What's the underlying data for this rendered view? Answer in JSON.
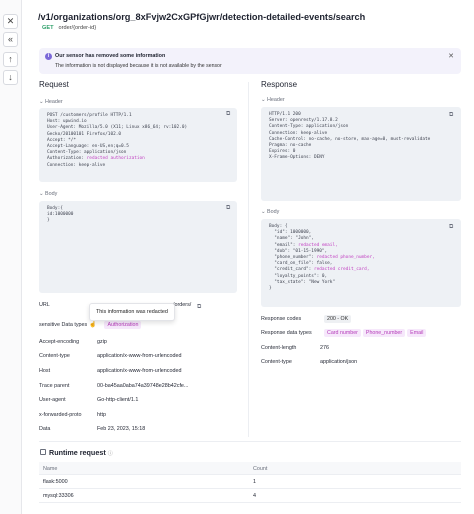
{
  "rail": {
    "close": "✕",
    "collapse": "«",
    "up": "↑",
    "down": "↓"
  },
  "header": {
    "title": "/v1/organizations/org_8xFvjw2CxGPfGjwr/detection-detailed-events/search",
    "method": "GET",
    "route": "order/{order-id}"
  },
  "alert": {
    "title": "Our sensor has removed some information",
    "text": "The information is not displayed because it is not available by the sensor"
  },
  "request": {
    "title": "Request",
    "header_label": "Header",
    "header_code": [
      "POST /customers/profile HTTP/1.1",
      "Host: upwind.io",
      "User-Agent: Mozilla/5.0 (X11; Linux x86_64; rv:102.0)",
      "Gecko/20100101 Firefox/102.0",
      "Accept: */*",
      "Accept-Language: en-US,en;q=0.5",
      "Content-Type: application/json",
      "Authorization: ",
      "Connection: keep-alive"
    ],
    "header_redacted": "redacted authorization",
    "body_label": "Body",
    "body_code": [
      "Body:{",
      "id:1000000",
      "}"
    ],
    "fields": [
      {
        "key": "URL",
        "value": "/orders/"
      },
      {
        "key": "sensitive Data types",
        "tag": "Authorization"
      },
      {
        "key": "Accept-encoding",
        "value": "gzip"
      },
      {
        "key": "Content-type",
        "value": "application/x-www-from-urlencoded"
      },
      {
        "key": "Host",
        "value": "application/x-www-from-urlencoded"
      },
      {
        "key": "Trace parent",
        "value": "00-ba45aa0aba74a39748e28b42cfe..."
      },
      {
        "key": "User-agent",
        "value": "Go-http-client/1.1"
      },
      {
        "key": "x-forwarded-proto",
        "value": "http"
      },
      {
        "key": "Data",
        "value": "Feb 23, 2023, 15:18"
      }
    ],
    "tooltip": "This information was redacted"
  },
  "response": {
    "title": "Response",
    "header_label": "Header",
    "header_code": [
      "HTTP/1.1 200",
      "Server: openresty/1.17.8.2",
      "Content-Type: application/json",
      "Connection: keep-alive",
      "Cache-Control: no-cache, no-store, max-age=0, must-revalidate",
      "Pragma: no-cache",
      "Expires: 0",
      "X-Frame-Options: DENY"
    ],
    "body_label": "Body",
    "body_code": [
      "Body: {",
      "  \"id\": 1000000,",
      "  \"name\": \"John\",",
      "  \"email\": ",
      "  \"dob\": \"01-15-1990\",",
      "  \"phone_number\": ",
      "  \"card_on_file\": false,",
      "  \"credit_card\": ",
      "  \"loyalty_points\": 0,",
      "  \"tax_state\": \"New York\"",
      "}"
    ],
    "body_redacted": {
      "email": "redacted email,",
      "phone": "redacted phone_number,",
      "card": "redacted credit_card,"
    },
    "fields": [
      {
        "key": "Response codes",
        "tag": "200 - OK"
      },
      {
        "key": "Response data types",
        "tags": [
          "Card number",
          "Phone_number",
          "Email"
        ]
      },
      {
        "key": "Content-length",
        "value": "276"
      },
      {
        "key": "Content-type",
        "value": "application/json"
      }
    ]
  },
  "runtime": {
    "title": "Runtime request",
    "columns": [
      "Name",
      "Count"
    ],
    "rows": [
      {
        "name": "flask:5000",
        "count": "1"
      },
      {
        "name": "mysql:33306",
        "count": "4"
      }
    ]
  },
  "colors": {
    "accent": "#b43ab8",
    "method": "#2fa06a",
    "alert_bg": "#f3f2fb",
    "code_bg": "#eef1f5"
  }
}
